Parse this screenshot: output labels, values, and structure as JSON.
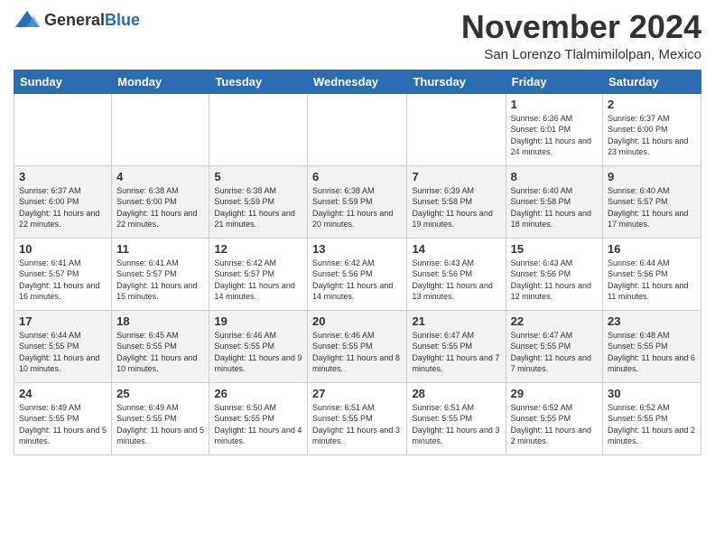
{
  "header": {
    "logo": {
      "general": "General",
      "blue": "Blue"
    },
    "title": "November 2024",
    "location": "San Lorenzo Tlalmimilolpan, Mexico"
  },
  "days_of_week": [
    "Sunday",
    "Monday",
    "Tuesday",
    "Wednesday",
    "Thursday",
    "Friday",
    "Saturday"
  ],
  "weeks": [
    [
      {
        "day": "",
        "info": ""
      },
      {
        "day": "",
        "info": ""
      },
      {
        "day": "",
        "info": ""
      },
      {
        "day": "",
        "info": ""
      },
      {
        "day": "",
        "info": ""
      },
      {
        "day": "1",
        "info": "Sunrise: 6:36 AM\nSunset: 6:01 PM\nDaylight: 11 hours and 24 minutes."
      },
      {
        "day": "2",
        "info": "Sunrise: 6:37 AM\nSunset: 6:00 PM\nDaylight: 11 hours and 23 minutes."
      }
    ],
    [
      {
        "day": "3",
        "info": "Sunrise: 6:37 AM\nSunset: 6:00 PM\nDaylight: 11 hours and 22 minutes."
      },
      {
        "day": "4",
        "info": "Sunrise: 6:38 AM\nSunset: 6:00 PM\nDaylight: 11 hours and 22 minutes."
      },
      {
        "day": "5",
        "info": "Sunrise: 6:38 AM\nSunset: 5:59 PM\nDaylight: 11 hours and 21 minutes."
      },
      {
        "day": "6",
        "info": "Sunrise: 6:38 AM\nSunset: 5:59 PM\nDaylight: 11 hours and 20 minutes."
      },
      {
        "day": "7",
        "info": "Sunrise: 6:39 AM\nSunset: 5:58 PM\nDaylight: 11 hours and 19 minutes."
      },
      {
        "day": "8",
        "info": "Sunrise: 6:40 AM\nSunset: 5:58 PM\nDaylight: 11 hours and 18 minutes."
      },
      {
        "day": "9",
        "info": "Sunrise: 6:40 AM\nSunset: 5:57 PM\nDaylight: 11 hours and 17 minutes."
      }
    ],
    [
      {
        "day": "10",
        "info": "Sunrise: 6:41 AM\nSunset: 5:57 PM\nDaylight: 11 hours and 16 minutes."
      },
      {
        "day": "11",
        "info": "Sunrise: 6:41 AM\nSunset: 5:57 PM\nDaylight: 11 hours and 15 minutes."
      },
      {
        "day": "12",
        "info": "Sunrise: 6:42 AM\nSunset: 5:57 PM\nDaylight: 11 hours and 14 minutes."
      },
      {
        "day": "13",
        "info": "Sunrise: 6:42 AM\nSunset: 5:56 PM\nDaylight: 11 hours and 14 minutes."
      },
      {
        "day": "14",
        "info": "Sunrise: 6:43 AM\nSunset: 5:56 PM\nDaylight: 11 hours and 13 minutes."
      },
      {
        "day": "15",
        "info": "Sunrise: 6:43 AM\nSunset: 5:56 PM\nDaylight: 11 hours and 12 minutes."
      },
      {
        "day": "16",
        "info": "Sunrise: 6:44 AM\nSunset: 5:56 PM\nDaylight: 11 hours and 11 minutes."
      }
    ],
    [
      {
        "day": "17",
        "info": "Sunrise: 6:44 AM\nSunset: 5:55 PM\nDaylight: 11 hours and 10 minutes."
      },
      {
        "day": "18",
        "info": "Sunrise: 6:45 AM\nSunset: 5:55 PM\nDaylight: 11 hours and 10 minutes."
      },
      {
        "day": "19",
        "info": "Sunrise: 6:46 AM\nSunset: 5:55 PM\nDaylight: 11 hours and 9 minutes."
      },
      {
        "day": "20",
        "info": "Sunrise: 6:46 AM\nSunset: 5:55 PM\nDaylight: 11 hours and 8 minutes."
      },
      {
        "day": "21",
        "info": "Sunrise: 6:47 AM\nSunset: 5:55 PM\nDaylight: 11 hours and 7 minutes."
      },
      {
        "day": "22",
        "info": "Sunrise: 6:47 AM\nSunset: 5:55 PM\nDaylight: 11 hours and 7 minutes."
      },
      {
        "day": "23",
        "info": "Sunrise: 6:48 AM\nSunset: 5:55 PM\nDaylight: 11 hours and 6 minutes."
      }
    ],
    [
      {
        "day": "24",
        "info": "Sunrise: 6:49 AM\nSunset: 5:55 PM\nDaylight: 11 hours and 5 minutes."
      },
      {
        "day": "25",
        "info": "Sunrise: 6:49 AM\nSunset: 5:55 PM\nDaylight: 11 hours and 5 minutes."
      },
      {
        "day": "26",
        "info": "Sunrise: 6:50 AM\nSunset: 5:55 PM\nDaylight: 11 hours and 4 minutes."
      },
      {
        "day": "27",
        "info": "Sunrise: 6:51 AM\nSunset: 5:55 PM\nDaylight: 11 hours and 3 minutes."
      },
      {
        "day": "28",
        "info": "Sunrise: 6:51 AM\nSunset: 5:55 PM\nDaylight: 11 hours and 3 minutes."
      },
      {
        "day": "29",
        "info": "Sunrise: 6:52 AM\nSunset: 5:55 PM\nDaylight: 11 hours and 2 minutes."
      },
      {
        "day": "30",
        "info": "Sunrise: 6:52 AM\nSunset: 5:55 PM\nDaylight: 11 hours and 2 minutes."
      }
    ]
  ]
}
